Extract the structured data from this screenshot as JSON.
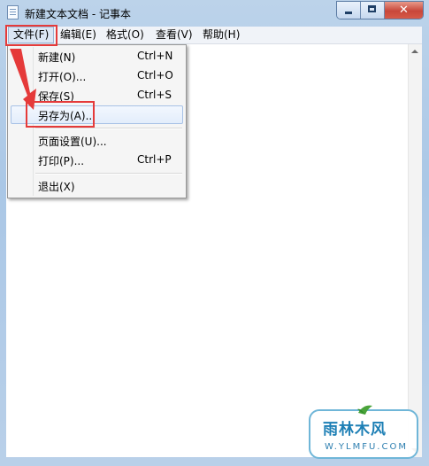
{
  "window": {
    "title": "新建文本文档 - 记事本",
    "controls": {
      "minimize_icon": "minimize-icon",
      "maximize_icon": "maximize-icon",
      "close_icon": "close-icon"
    }
  },
  "menubar": {
    "items": [
      {
        "label": "文件(F)"
      },
      {
        "label": "编辑(E)"
      },
      {
        "label": "格式(O)"
      },
      {
        "label": "查看(V)"
      },
      {
        "label": "帮助(H)"
      }
    ],
    "active": "文件(F)"
  },
  "file_menu": {
    "items": [
      {
        "label": "新建(N)",
        "shortcut": "Ctrl+N"
      },
      {
        "label": "打开(O)...",
        "shortcut": "Ctrl+O"
      },
      {
        "label": "保存(S)",
        "shortcut": "Ctrl+S"
      },
      {
        "label": "另存为(A)...",
        "shortcut": ""
      },
      {
        "label": "页面设置(U)...",
        "shortcut": ""
      },
      {
        "label": "打印(P)...",
        "shortcut": "Ctrl+P"
      },
      {
        "label": "退出(X)",
        "shortcut": ""
      }
    ],
    "hovered": "另存为(A)..."
  },
  "annotation": {
    "color": "#e53a3a"
  },
  "watermark": {
    "title": "雨林木风",
    "url": "W.YLMFU.COM"
  },
  "colors": {
    "hover_border": "#a8c2e6",
    "highlight": "#e53a3a",
    "watermark": "#1d7fb5"
  }
}
